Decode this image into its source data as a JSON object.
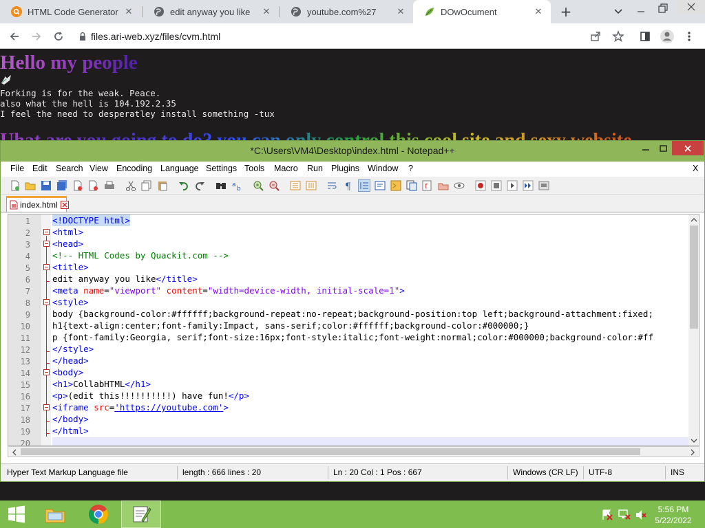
{
  "browser": {
    "tabs": [
      {
        "title": "HTML Code Generator",
        "icon": "quackit-favicon"
      },
      {
        "title": "edit anyway you like",
        "icon": "globe-icon"
      },
      {
        "title": "youtube.com%27",
        "icon": "globe-icon"
      },
      {
        "title": "DOwOcument",
        "icon": "leaf-favicon",
        "active": true
      }
    ],
    "close_glyph": "✕",
    "new_tab_glyph": "+",
    "url": "files.ari-web.xyz/files/cvm.html"
  },
  "page": {
    "heading": "Hello my people",
    "lines": [
      "Forking is for the weak. Peace.",
      "also what the hell is 104.192.2.35",
      "I feel the need to desperatley install something -tux"
    ],
    "rainbow_text": "Uhat are you going to do? you can only control this cool site and sexy website"
  },
  "notepad": {
    "title": "*C:\\Users\\VM4\\Desktop\\index.html - Notepad++",
    "menu": [
      "File",
      "Edit",
      "Search",
      "View",
      "Encoding",
      "Language",
      "Settings",
      "Tools",
      "Macro",
      "Run",
      "Plugins",
      "Window",
      "?"
    ],
    "menu_close": "X",
    "file_tab": "index.html",
    "line_numbers": [
      "1",
      "2",
      "3",
      "4",
      "5",
      "6",
      "7",
      "8",
      "9",
      "10",
      "11",
      "12",
      "13",
      "14",
      "15",
      "16",
      "17",
      "18",
      "19",
      "20"
    ],
    "code": {
      "l1": "<!DOCTYPE html>",
      "l2": "<html>",
      "l3": "<head>",
      "l4": "<!-- HTML Codes by Quackit.com -->",
      "l5": "<title>",
      "l6a": "edit anyway you like",
      "l6b": "</title>",
      "l7a": "<meta ",
      "l7b": "name",
      "l7c": "=",
      "l7d": "\"viewport\"",
      "l7e": " content",
      "l7f": "=",
      "l7g": "\"width=device-width, initial-scale=1\"",
      "l7h": ">",
      "l8": "<style>",
      "l9": "body {background-color:#ffffff;background-repeat:no-repeat;background-position:top left;background-attachment:fixed;",
      "l10": "h1{text-align:center;font-family:Impact, sans-serif;color:#ffffff;background-color:#000000;}",
      "l11": "p {font-family:Georgia, serif;font-size:16px;font-style:italic;font-weight:normal;color:#000000;background-color:#ff",
      "l12": "</style>",
      "l13": "</head>",
      "l14": "<body>",
      "l15a": "<h1>",
      "l15b": "CollabHTML",
      "l15c": "</h1>",
      "l16a": "<p>",
      "l16b": "(edit this!!!!!!!!!!) have fun!",
      "l16c": "</p>",
      "l17a": "<iframe ",
      "l17b": "src",
      "l17c": "=",
      "l17d": "'https://youtube.com'",
      "l17e": ">",
      "l18": "</body>",
      "l19": "</html>"
    },
    "status": {
      "type": "Hyper Text Markup Language file",
      "length": "length : 666    lines : 20",
      "pos": "Ln : 20    Col : 1    Pos : 667",
      "eol": "Windows (CR LF)",
      "enc": "UTF-8",
      "mode": "INS"
    }
  },
  "taskbar": {
    "time": "5:56 PM",
    "date": "5/22/2022"
  },
  "colors": {
    "accent_green": "#8fb75a",
    "taskbar_green": "#7ebd4e",
    "close_red": "#c94040"
  }
}
